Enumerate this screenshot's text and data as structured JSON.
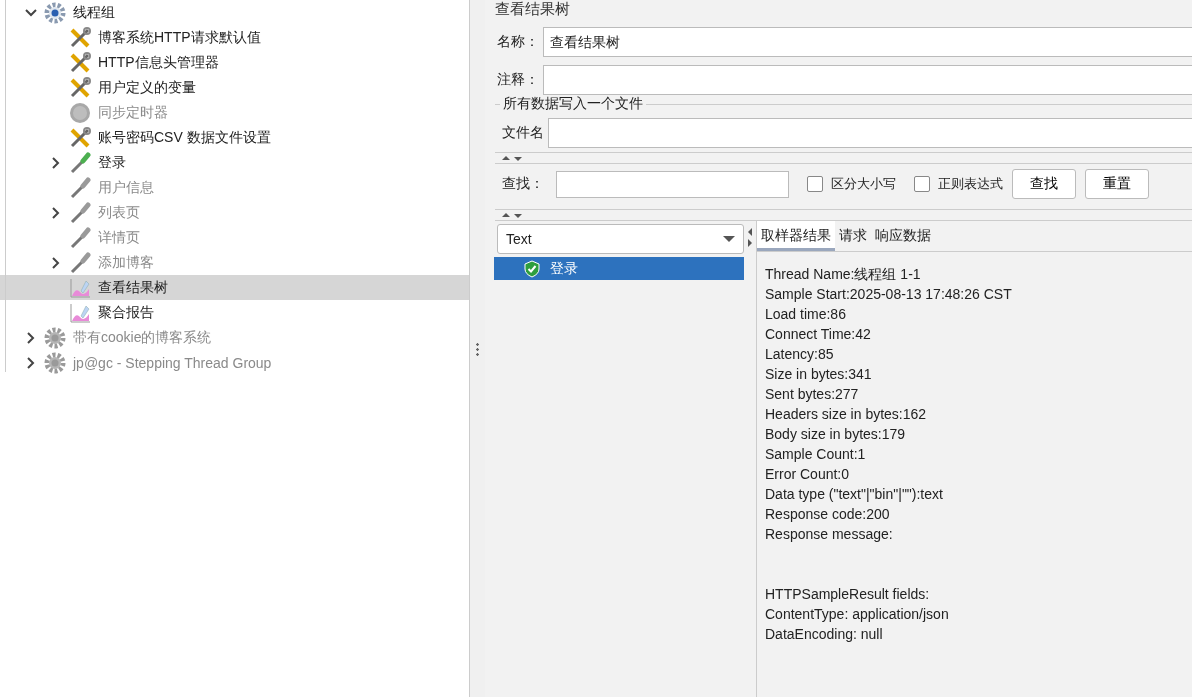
{
  "tree": [
    {
      "label": "线程组",
      "kind": "gear",
      "disabled": false,
      "selected": false,
      "expanded": true,
      "children": [
        {
          "label": "博客系统HTTP请求默认值",
          "kind": "wrench",
          "disabled": false,
          "selected": false
        },
        {
          "label": "HTTP信息头管理器",
          "kind": "wrench",
          "disabled": false,
          "selected": false
        },
        {
          "label": "用户定义的变量",
          "kind": "wrench",
          "disabled": false,
          "selected": false
        },
        {
          "label": "同步定时器",
          "kind": "timer",
          "disabled": true,
          "selected": false
        },
        {
          "label": "账号密码CSV 数据文件设置",
          "kind": "wrench",
          "disabled": false,
          "selected": false
        },
        {
          "label": "登录",
          "kind": "pipette",
          "disabled": false,
          "selected": false,
          "expanded": false
        },
        {
          "label": "用户信息",
          "kind": "pipette",
          "disabled": true,
          "selected": false
        },
        {
          "label": "列表页",
          "kind": "pipette",
          "disabled": true,
          "selected": false,
          "expanded": false
        },
        {
          "label": "详情页",
          "kind": "pipette",
          "disabled": true,
          "selected": false
        },
        {
          "label": "添加博客",
          "kind": "pipette",
          "disabled": true,
          "selected": false,
          "expanded": false
        },
        {
          "label": "查看结果树",
          "kind": "chart",
          "disabled": false,
          "selected": true
        },
        {
          "label": "聚合报告",
          "kind": "chart",
          "disabled": false,
          "selected": false
        }
      ]
    },
    {
      "label": "带有cookie的博客系统",
      "kind": "gear",
      "disabled": true,
      "selected": false,
      "expanded": false
    },
    {
      "label": "jp@gc - Stepping Thread Group",
      "kind": "gear",
      "disabled": true,
      "selected": false,
      "expanded": false
    }
  ],
  "panel": {
    "title": "查看结果树",
    "name_label": "名称：",
    "name_value": "查看结果树",
    "comment_label": "注释：",
    "file_group": "所有数据写入一个文件",
    "file_label": "文件名",
    "search_label": "查找：",
    "case_label": "区分大小写",
    "case_checked": false,
    "regex_label": "正则表达式",
    "regex_checked": false,
    "buttons": [
      "查找",
      "重置"
    ]
  },
  "results": {
    "renderer": "Text",
    "samples": [
      {
        "label": "登录",
        "selected": true
      }
    ],
    "tabs": [
      {
        "label": "取样器结果",
        "selected": true
      },
      {
        "label": "请求",
        "selected": false
      },
      {
        "label": "响应数据",
        "selected": false
      }
    ],
    "lines": [
      "Thread Name:线程组 1-1",
      "Sample Start:2025-08-13 17:48:26 CST",
      "Load time:86",
      "Connect Time:42",
      "Latency:85",
      "Size in bytes:341",
      "Sent bytes:277",
      "Headers size in bytes:162",
      "Body size in bytes:179",
      "Sample Count:1",
      "Error Count:0",
      "Data type (\"text\"|\"bin\"|\"\"):text",
      "Response code:200",
      "Response message:"
    ],
    "field_lines": [
      "HTTPSampleResult fields:",
      "ContentType: application/json",
      "DataEncoding: null"
    ]
  }
}
